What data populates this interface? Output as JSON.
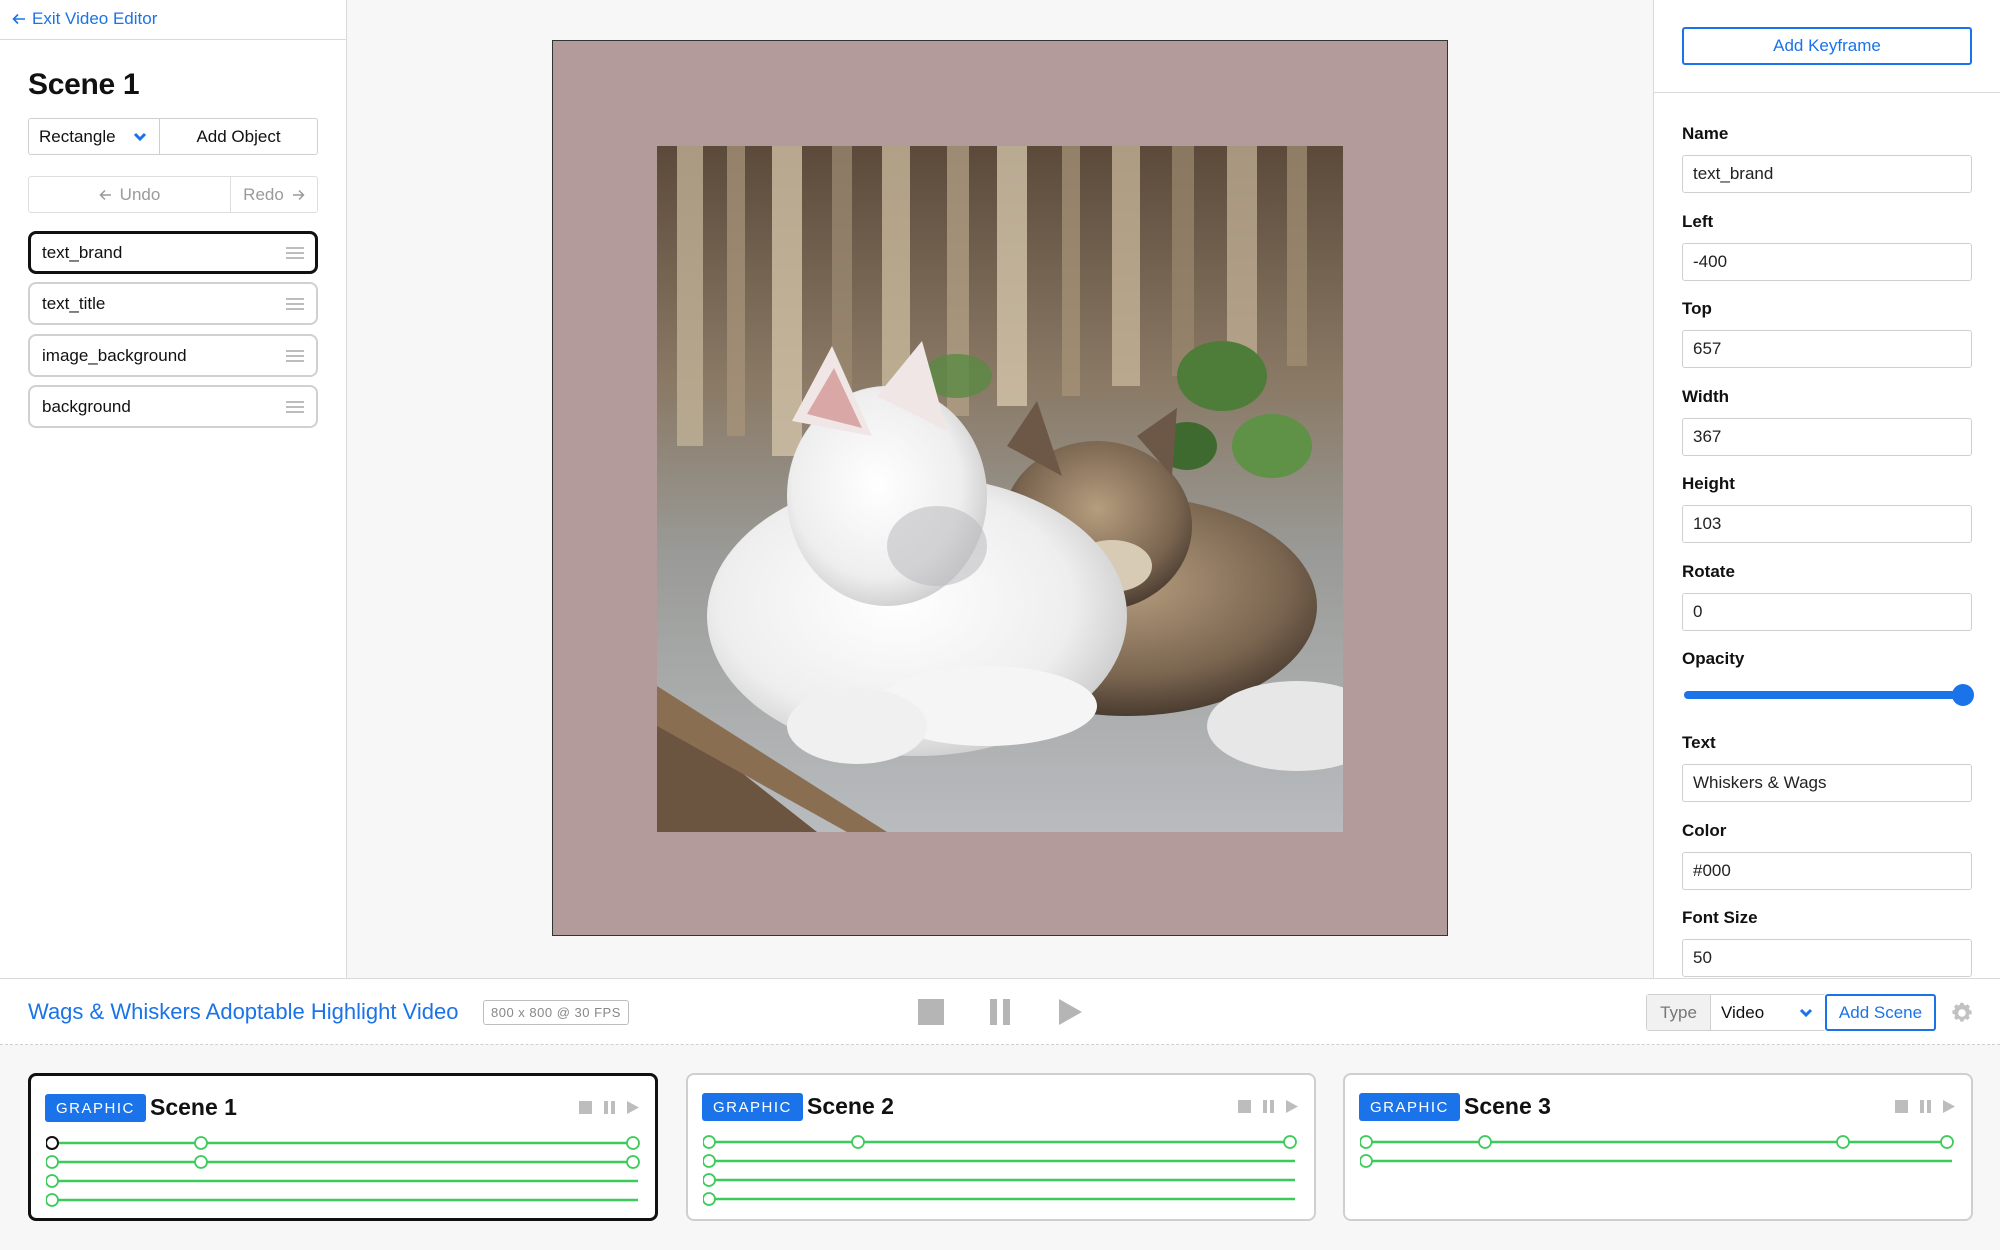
{
  "left_panel": {
    "exit_link": "Exit Video Editor",
    "scene_title": "Scene 1",
    "shape_select": "Rectangle",
    "add_object": "Add Object",
    "undo": "Undo",
    "redo": "Redo",
    "layers": [
      "text_brand",
      "text_title",
      "image_background",
      "background"
    ],
    "selected_layer": "text_brand"
  },
  "canvas": {
    "background_color": "#b39b9c",
    "image": "two cats resting together photo"
  },
  "right_panel": {
    "add_keyframe": "Add Keyframe",
    "name_label": "Name",
    "name_value": "text_brand",
    "left_label": "Left",
    "left_value": "-400",
    "top_label": "Top",
    "top_value": "657",
    "width_label": "Width",
    "width_value": "367",
    "height_label": "Height",
    "height_value": "103",
    "rotate_label": "Rotate",
    "rotate_value": "0",
    "opacity_label": "Opacity",
    "opacity_value": 1.0,
    "text_label": "Text",
    "text_value": "Whiskers & Wags",
    "color_label": "Color",
    "color_value": "#000",
    "font_size_label": "Font Size",
    "font_size_value": "50"
  },
  "bottom_bar": {
    "project_title": "Wags & Whiskers Adoptable Highlight Video",
    "project_meta": "800 x 800 @ 30 FPS",
    "type_label": "Type",
    "type_value": "Video",
    "add_scene": "Add Scene"
  },
  "scenes": [
    {
      "badge": "GRAPHIC",
      "title": "Scene 1",
      "selected": true
    },
    {
      "badge": "GRAPHIC",
      "title": "Scene 2",
      "selected": false
    },
    {
      "badge": "GRAPHIC",
      "title": "Scene 3",
      "selected": false
    }
  ],
  "colors": {
    "accent": "#1a73e8",
    "track": "#3ccb5a",
    "canvas_bg": "#b39b9c"
  },
  "icons": [
    "arrow-left-icon",
    "chevron-down-icon",
    "drag-handle-icon",
    "stop-icon",
    "pause-icon",
    "play-icon",
    "gear-icon"
  ]
}
